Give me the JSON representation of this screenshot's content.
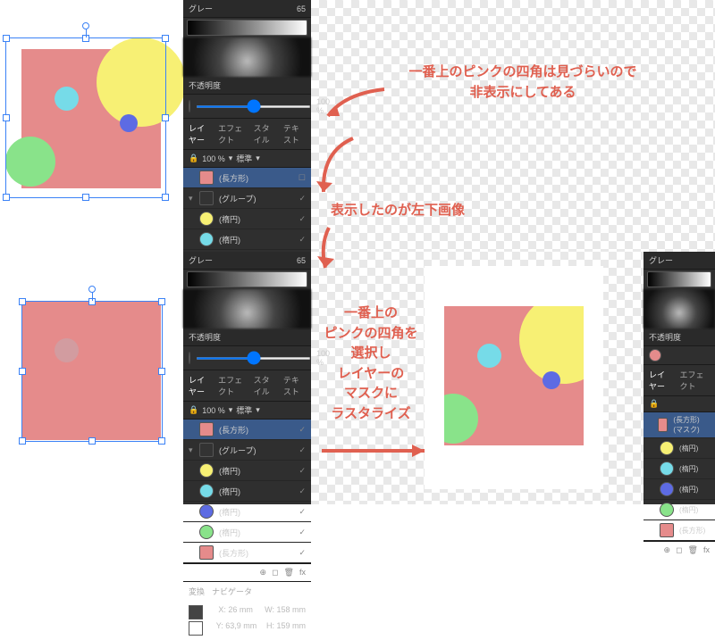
{
  "panels": {
    "slider_label": "グレー",
    "slider_value": "65",
    "opacity_label": "不透明度",
    "opacity_value": "100 %",
    "tabs": {
      "layer": "レイヤー",
      "effect": "エフェクト",
      "style": "スタイル",
      "text": "テキスト"
    },
    "blend_row": {
      "pct": "100 %",
      "blend": "標準"
    },
    "trans_tabs": {
      "transform": "変換",
      "navi": "ナビゲータ"
    },
    "dims": {
      "x": "X: 26 mm",
      "w": "W: 158 mm",
      "y": "Y: 63,9 mm",
      "h": "H: 159 mm"
    },
    "rect_layer": "(長方形)",
    "mask_layer": "(長方形) (マスク)",
    "group_layer": "(グループ)",
    "ellipse_layer": "(楕円)"
  },
  "annotations": {
    "a1": "一番上のピンクの四角は見づらいので\n非表示にしてある",
    "a2": "表示したのが左下画像",
    "a3": "一番上の\nピンクの四角を\n選択し\nレイヤーの\nマスクに\nラスタライズ"
  },
  "swatches": {
    "pink": "#e58b8b",
    "yellow": "#f7f074",
    "cyan": "#76dbe8",
    "blue": "#5d6be3",
    "green": "#89e38a"
  }
}
